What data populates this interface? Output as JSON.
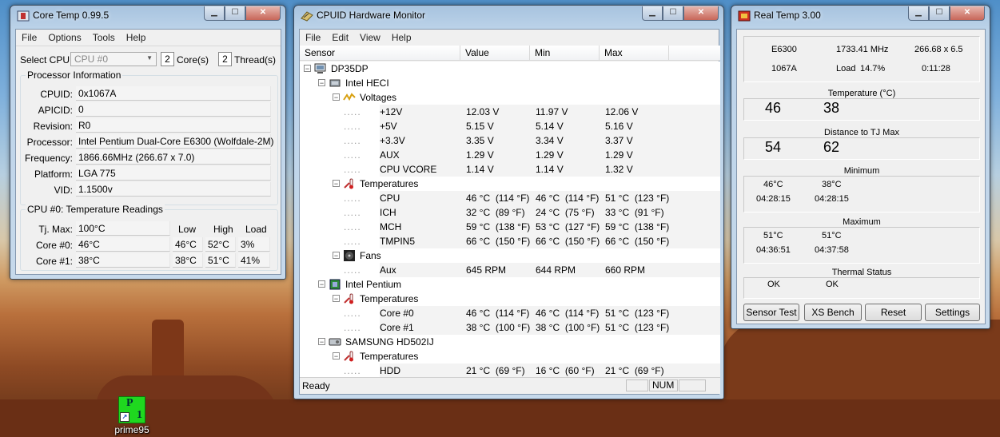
{
  "core_temp": {
    "title": "Core Temp 0.99.5",
    "menu": [
      "File",
      "Options",
      "Tools",
      "Help"
    ],
    "select_cpu_label": "Select CPU:",
    "select_cpu_value": "CPU #0",
    "cores_count": "2",
    "cores_label": "Core(s)",
    "threads_count": "2",
    "threads_label": "Thread(s)",
    "processor_info_title": "Processor Information",
    "fields": [
      {
        "label": "CPUID:",
        "value": "0x1067A"
      },
      {
        "label": "APICID:",
        "value": "0"
      },
      {
        "label": "Revision:",
        "value": "R0"
      },
      {
        "label": "Processor:",
        "value": "Intel Pentium Dual-Core E6300 (Wolfdale-2M)"
      },
      {
        "label": "Frequency:",
        "value": "1866.66MHz (266.67 x 7.0)"
      },
      {
        "label": "Platform:",
        "value": "LGA 775"
      },
      {
        "label": "VID:",
        "value": "1.1500v"
      }
    ],
    "readings_title": "CPU #0: Temperature Readings",
    "tjmax_label": "Tj. Max:",
    "tjmax_value": "100°C",
    "col_low": "Low",
    "col_high": "High",
    "col_load": "Load",
    "cores": [
      {
        "label": "Core #0:",
        "temp": "46°C",
        "low": "46°C",
        "high": "52°C",
        "load": "3%"
      },
      {
        "label": "Core #1:",
        "temp": "38°C",
        "low": "38°C",
        "high": "51°C",
        "load": "41%"
      }
    ]
  },
  "cpuid": {
    "title": "CPUID Hardware Monitor",
    "menu": [
      "File",
      "Edit",
      "View",
      "Help"
    ],
    "headers": {
      "sensor": "Sensor",
      "value": "Value",
      "min": "Min",
      "max": "Max"
    },
    "rows": [
      {
        "level": 0,
        "label": "DP35DP",
        "icon": "computer-icon",
        "toggle": "-"
      },
      {
        "level": 1,
        "label": "Intel HECI",
        "icon": "chip-icon",
        "toggle": "-"
      },
      {
        "level": 2,
        "label": "Voltages",
        "icon": "voltage-icon",
        "toggle": "-"
      },
      {
        "level": 3,
        "label": "+12V",
        "value": "12.03 V",
        "min": "11.97 V",
        "max": "12.06 V"
      },
      {
        "level": 3,
        "label": "+5V",
        "value": "5.15 V",
        "min": "5.14 V",
        "max": "5.16 V"
      },
      {
        "level": 3,
        "label": "+3.3V",
        "value": "3.35 V",
        "min": "3.34 V",
        "max": "3.37 V"
      },
      {
        "level": 3,
        "label": "AUX",
        "value": "1.29 V",
        "min": "1.29 V",
        "max": "1.29 V"
      },
      {
        "level": 3,
        "label": "CPU VCORE",
        "value": "1.14 V",
        "min": "1.14 V",
        "max": "1.32 V"
      },
      {
        "level": 2,
        "label": "Temperatures",
        "icon": "thermometer-icon",
        "toggle": "-"
      },
      {
        "level": 3,
        "label": "CPU",
        "value": "46 °C  (114 °F)",
        "min": "46 °C  (114 °F)",
        "max": "51 °C  (123 °F)"
      },
      {
        "level": 3,
        "label": "ICH",
        "value": "32 °C  (89 °F)",
        "min": "24 °C  (75 °F)",
        "max": "33 °C  (91 °F)"
      },
      {
        "level": 3,
        "label": "MCH",
        "value": "59 °C  (138 °F)",
        "min": "53 °C  (127 °F)",
        "max": "59 °C  (138 °F)"
      },
      {
        "level": 3,
        "label": "TMPIN5",
        "value": "66 °C  (150 °F)",
        "min": "66 °C  (150 °F)",
        "max": "66 °C  (150 °F)"
      },
      {
        "level": 2,
        "label": "Fans",
        "icon": "fan-icon",
        "toggle": "-"
      },
      {
        "level": 3,
        "label": "Aux",
        "value": "645 RPM",
        "min": "644 RPM",
        "max": "660 RPM"
      },
      {
        "level": 1,
        "label": "Intel Pentium",
        "icon": "cpu-icon",
        "toggle": "-"
      },
      {
        "level": 2,
        "label": "Temperatures",
        "icon": "thermometer-icon",
        "toggle": "-"
      },
      {
        "level": 3,
        "label": "Core #0",
        "value": "46 °C  (114 °F)",
        "min": "46 °C  (114 °F)",
        "max": "51 °C  (123 °F)"
      },
      {
        "level": 3,
        "label": "Core #1",
        "value": "38 °C  (100 °F)",
        "min": "38 °C  (100 °F)",
        "max": "51 °C  (123 °F)"
      },
      {
        "level": 1,
        "label": "SAMSUNG HD502IJ",
        "icon": "harddisk-icon",
        "toggle": "-"
      },
      {
        "level": 2,
        "label": "Temperatures",
        "icon": "thermometer-icon",
        "toggle": "-"
      },
      {
        "level": 3,
        "label": "HDD",
        "value": "21 °C  (69 °F)",
        "min": "16 °C  (60 °F)",
        "max": "21 °C  (69 °F)"
      }
    ],
    "status_text": "Ready",
    "status_num": "NUM"
  },
  "real_temp": {
    "title": "Real Temp 3.00",
    "cpu_model": "E6300",
    "frequency": "1733.41 MHz",
    "multiplier": "266.68 x 6.5",
    "cpuid": "1067A",
    "load_label": "Load",
    "load_value": "14.7%",
    "uptime": "0:11:28",
    "temperature_title": "Temperature (°C)",
    "temp_core0": "46",
    "temp_core1": "38",
    "distance_title": "Distance to TJ Max",
    "dist_core0": "54",
    "dist_core1": "62",
    "minimum_title": "Minimum",
    "min_core0_temp": "46°C",
    "min_core1_temp": "38°C",
    "min_core0_time": "04:28:15",
    "min_core1_time": "04:28:15",
    "maximum_title": "Maximum",
    "max_core0_temp": "51°C",
    "max_core1_temp": "51°C",
    "max_core0_time": "04:36:51",
    "max_core1_time": "04:37:58",
    "thermal_title": "Thermal Status",
    "thermal_core0": "OK",
    "thermal_core1": "OK",
    "buttons": {
      "sensor_test": "Sensor Test",
      "xs_bench": "XS Bench",
      "reset": "Reset",
      "settings": "Settings"
    }
  },
  "desktop": {
    "icon_label": "prime95"
  }
}
